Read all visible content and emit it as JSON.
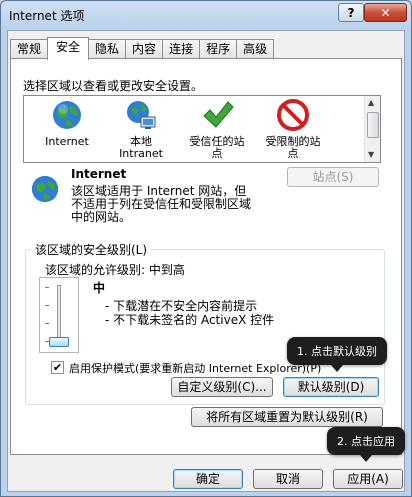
{
  "window": {
    "title": "Internet 选项",
    "help": "?",
    "close": "✕"
  },
  "tabs": [
    "常规",
    "安全",
    "隐私",
    "内容",
    "连接",
    "程序",
    "高级"
  ],
  "security": {
    "zone_prompt": "选择区域以查看或更改安全设置。",
    "zones": [
      {
        "label": "Internet"
      },
      {
        "label": "本地\nIntranet"
      },
      {
        "label": "受信任的站\n点"
      },
      {
        "label": "受限制的站\n点"
      }
    ],
    "selected_zone": "Internet",
    "zone_description": "该区域适用于 Internet 网站，但\n不适用于列在受信任和受限制区域\n中的网站。",
    "sites_button": "站点(S)",
    "level_group_title": "该区域的安全级别(L)",
    "allowed_levels": "该区域的允许级别: 中到高",
    "level_name": "中",
    "level_points": [
      "- 下载潜在不安全内容前提示",
      "- 不下载未签名的 ActiveX 控件"
    ],
    "protected_mode_label": "启用保护模式(要求重新启动 Internet Explorer)(P)",
    "protected_mode_checked": true,
    "custom_level_button": "自定义级别(C)...",
    "default_level_button": "默认级别(D)",
    "reset_all_button": "将所有区域重置为默认级别(R)"
  },
  "footer": {
    "ok": "确定",
    "cancel": "取消",
    "apply": "应用(A)"
  },
  "annotations": {
    "step1": "1. 点击默认级别",
    "step2": "2. 点击应用"
  }
}
